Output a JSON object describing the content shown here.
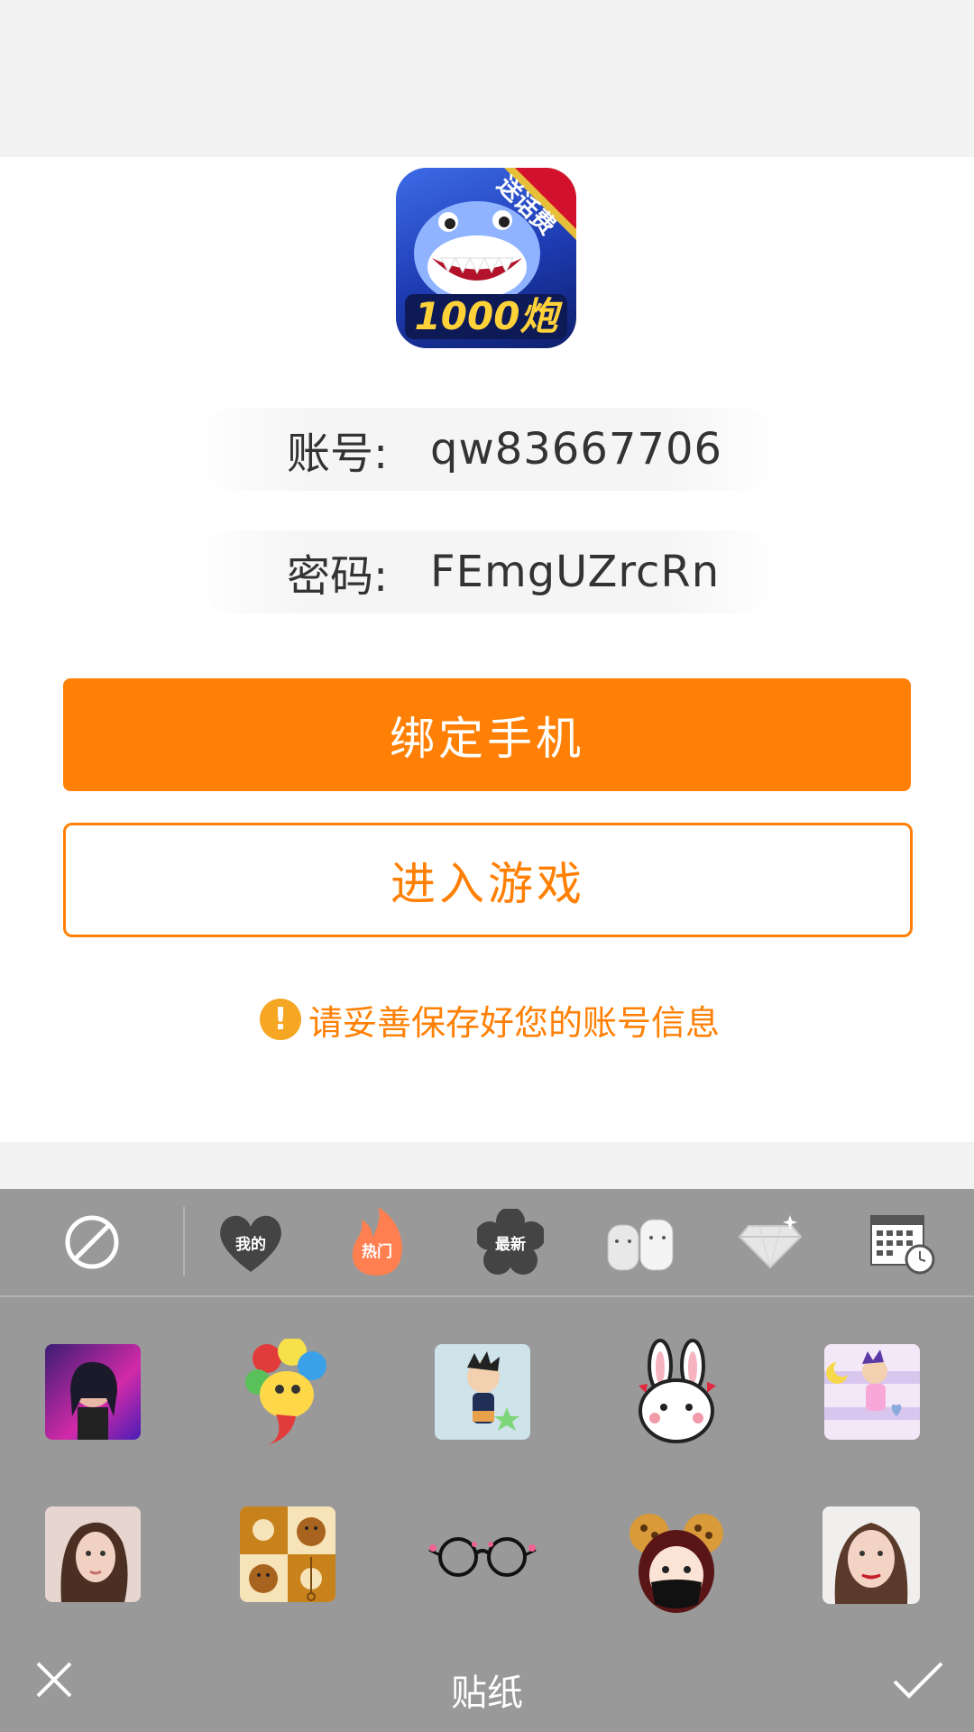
{
  "app": {
    "icon_badge": "送话费",
    "icon_caption": "1000炮"
  },
  "account": {
    "label": "账号:",
    "value": "qw83667706"
  },
  "password": {
    "label": "密码:",
    "value": "FEmgUZrcRn"
  },
  "buttons": {
    "bind_phone": "绑定手机",
    "enter_game": "进入游戏"
  },
  "warning": {
    "icon": "!",
    "text": "请妥善保存好您的账号信息"
  },
  "sticker_tabs": [
    {
      "name": "none-icon"
    },
    {
      "name": "my-heart-icon",
      "label": "我的"
    },
    {
      "name": "hot-flame-icon",
      "label": "热门"
    },
    {
      "name": "new-flower-icon",
      "label": "最新"
    },
    {
      "name": "bears-icon"
    },
    {
      "name": "diamond-icon"
    },
    {
      "name": "calendar-clock-icon"
    }
  ],
  "stickers": [
    "neon-girl",
    "flower-fish",
    "astro-boy",
    "bunny-face",
    "astro-boy-pastel",
    "girl-portrait",
    "rilakkuma",
    "glasses",
    "masked-girl",
    "woman-portrait"
  ],
  "footer": {
    "title": "贴纸",
    "cancel_icon": "close-icon",
    "confirm_icon": "check-icon"
  },
  "colors": {
    "accent": "#ff8005",
    "panel_bg": "#999999"
  }
}
